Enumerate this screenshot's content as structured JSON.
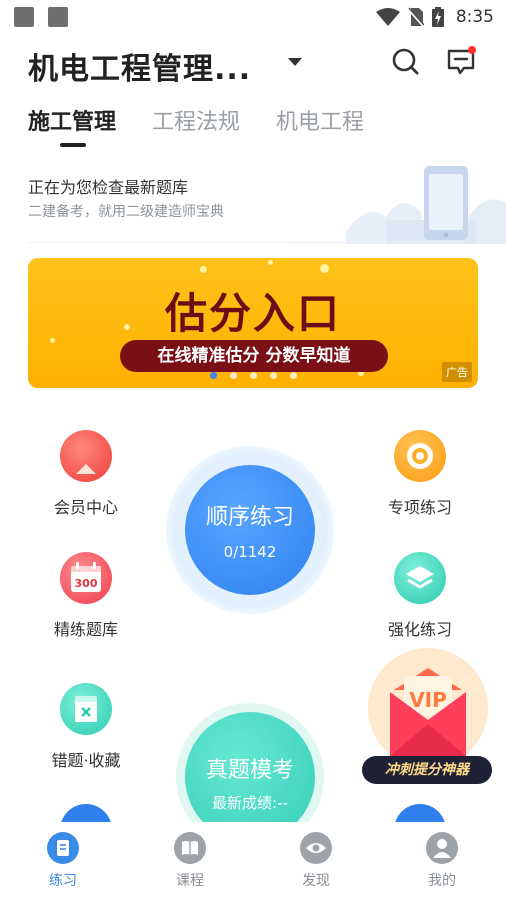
{
  "status_bar": {
    "time": "8:35"
  },
  "header": {
    "title": "机电工程管理..."
  },
  "tabs": [
    {
      "label": "施工管理",
      "active": true
    },
    {
      "label": "工程法规",
      "active": false
    },
    {
      "label": "机电工程",
      "active": false
    }
  ],
  "notice": {
    "title": "正在为您检查最新题库",
    "subtitle": "二建备考，就用二级建造师宝典"
  },
  "banner": {
    "title": "估分入口",
    "tagline": "在线精准估分 分数早知道",
    "ad_label": "广告",
    "dots": 5,
    "active_dot": 0
  },
  "features": {
    "member": "会员中心",
    "special": "专项练习",
    "question_bank": "精练题库",
    "question_bank_badge": "300",
    "intensive": "强化练习",
    "mistakes": "错题·收藏"
  },
  "sequential": {
    "title": "顺序练习",
    "progress": "0/1142"
  },
  "mock_exam": {
    "title": "真题模考",
    "score": "最新成绩:--"
  },
  "vip_promo": {
    "badge": "VIP",
    "caption": "冲刺提分神器"
  },
  "bottom_nav": [
    {
      "label": "练习",
      "active": true
    },
    {
      "label": "课程",
      "active": false
    },
    {
      "label": "发现",
      "active": false
    },
    {
      "label": "我的",
      "active": false
    }
  ],
  "colors": {
    "primary_blue": "#3a8be8",
    "banner_yellow": "#ffb800",
    "banner_text": "#6b0d12",
    "teal": "#3fd3c0",
    "notification_dot": "#ff2d2d"
  }
}
